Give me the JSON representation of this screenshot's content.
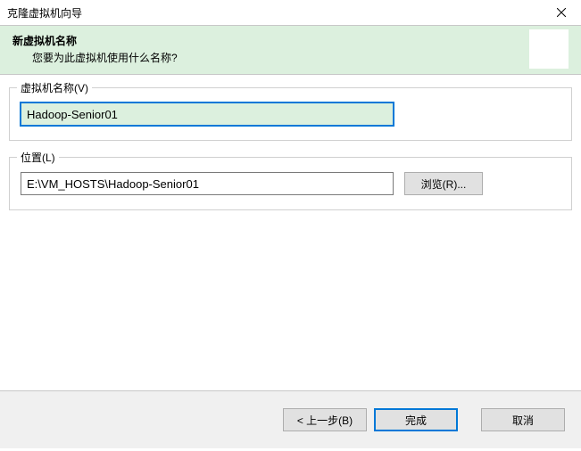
{
  "titlebar": {
    "title": "克隆虚拟机向导"
  },
  "header": {
    "title": "新虚拟机名称",
    "subtitle": "您要为此虚拟机使用什么名称?"
  },
  "vm_name": {
    "legend": "虚拟机名称(V)",
    "value": "Hadoop-Senior01"
  },
  "location": {
    "legend": "位置(L)",
    "value": "E:\\VM_HOSTS\\Hadoop-Senior01",
    "browse_label": "浏览(R)..."
  },
  "footer": {
    "back_label": "< 上一步(B)",
    "finish_label": "完成",
    "cancel_label": "取消"
  }
}
